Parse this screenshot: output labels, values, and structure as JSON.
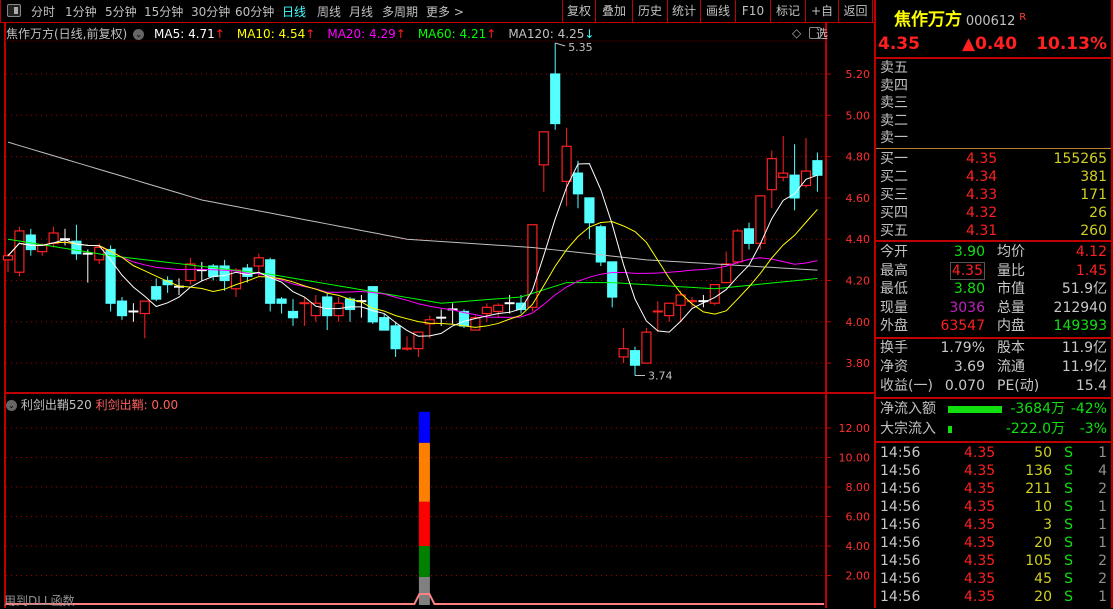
{
  "toolbar": {
    "periods": [
      "分时",
      "1分钟",
      "5分钟",
      "15分钟",
      "30分钟",
      "60分钟",
      "日线",
      "周线",
      "月线",
      "多周期",
      "更多 >"
    ],
    "active": "日线",
    "buttons": [
      "复权",
      "叠加",
      "历史",
      "统计",
      "画线",
      "F10",
      "标记",
      "+自选",
      "返回"
    ]
  },
  "main": {
    "title": "焦作万方(日线,前复权)",
    "ma": [
      {
        "label": "MA5: 4.71",
        "arrow": "↑",
        "color": "#ffffff"
      },
      {
        "label": "MA10: 4.54",
        "arrow": "↑",
        "color": "#ffff00"
      },
      {
        "label": "MA20: 4.29",
        "arrow": "↑",
        "color": "#ff00ff"
      },
      {
        "label": "MA60: 4.21",
        "arrow": "↑",
        "color": "#00ff00"
      },
      {
        "label": "MA120: 4.25",
        "arrow": "↓",
        "color": "#c0c0c0"
      }
    ],
    "high_marker": "5.35",
    "low_marker": "3.74"
  },
  "indicator": {
    "name": "利剑出鞘520",
    "series_label": "利剑出鞘: 0.00",
    "footer": "用到DLL函数"
  },
  "quote": {
    "name": "焦作万方",
    "code": "000612",
    "flag": "R",
    "price": "4.35",
    "change": "▲0.40",
    "pct": "10.13%",
    "sell": [
      {
        "label": "卖五"
      },
      {
        "label": "卖四"
      },
      {
        "label": "卖三"
      },
      {
        "label": "卖二"
      },
      {
        "label": "卖一"
      }
    ],
    "buy": [
      {
        "label": "买一",
        "price": "4.35",
        "vol": "155265"
      },
      {
        "label": "买二",
        "price": "4.34",
        "vol": "381"
      },
      {
        "label": "买三",
        "price": "4.33",
        "vol": "171"
      },
      {
        "label": "买四",
        "price": "4.32",
        "vol": "26"
      },
      {
        "label": "买五",
        "price": "4.31",
        "vol": "260"
      }
    ],
    "stats": [
      {
        "l1": "今开",
        "v1": "3.90",
        "c1": "grn",
        "l2": "均价",
        "v2": "4.12",
        "c2": "red"
      },
      {
        "l1": "最高",
        "v1": "4.35",
        "c1": "red",
        "l2": "量比",
        "v2": "1.45",
        "c2": "red"
      },
      {
        "l1": "最低",
        "v1": "3.80",
        "c1": "grn",
        "l2": "市值",
        "v2": "51.9亿",
        "c2": "wh"
      },
      {
        "l1": "现量",
        "v1": "3036",
        "c1": "mag",
        "l2": "总量",
        "v2": "212940",
        "c2": "wh"
      },
      {
        "l1": "外盘",
        "v1": "63547",
        "c1": "red",
        "l2": "内盘",
        "v2": "149393",
        "c2": "grn"
      }
    ],
    "fin": [
      {
        "l1": "换手",
        "v1": "1.79%",
        "l2": "股本",
        "v2": "11.9亿"
      },
      {
        "l1": "净资",
        "v1": "3.69",
        "l2": "流通",
        "v2": "11.9亿"
      },
      {
        "l1": "收益(一)",
        "v1": "0.070",
        "l2": "PE(动)",
        "v2": "15.4"
      }
    ],
    "flow": [
      {
        "label": "净流入额",
        "value": "-3684万",
        "pct": "-42%",
        "bar": 0.42
      },
      {
        "label": "大宗流入",
        "value": "-222.0万",
        "pct": "-3%",
        "bar": 0.03
      }
    ],
    "ticks": [
      {
        "t": "14:56",
        "p": "4.35",
        "v": "50",
        "s": "S",
        "n": "1"
      },
      {
        "t": "14:56",
        "p": "4.35",
        "v": "136",
        "s": "S",
        "n": "4"
      },
      {
        "t": "14:56",
        "p": "4.35",
        "v": "211",
        "s": "S",
        "n": "2"
      },
      {
        "t": "14:56",
        "p": "4.35",
        "v": "10",
        "s": "S",
        "n": "1"
      },
      {
        "t": "14:56",
        "p": "4.35",
        "v": "3",
        "s": "S",
        "n": "1"
      },
      {
        "t": "14:56",
        "p": "4.35",
        "v": "20",
        "s": "S",
        "n": "1"
      },
      {
        "t": "14:56",
        "p": "4.35",
        "v": "105",
        "s": "S",
        "n": "2"
      },
      {
        "t": "14:56",
        "p": "4.35",
        "v": "45",
        "s": "S",
        "n": "2"
      },
      {
        "t": "14:56",
        "p": "4.35",
        "v": "20",
        "s": "S",
        "n": "1"
      }
    ]
  },
  "chart_data": [
    {
      "type": "candlestick",
      "title": "焦作万方(日线,前复权)",
      "ylim": [
        3.72,
        5.38
      ],
      "yticks": [
        "5.20",
        "5.00",
        "4.80",
        "4.60",
        "4.40",
        "4.20",
        "4.00",
        "3.80"
      ],
      "ohlc": [
        [
          4.3,
          4.33,
          4.24,
          4.32
        ],
        [
          4.24,
          4.46,
          4.22,
          4.44
        ],
        [
          4.42,
          4.45,
          4.32,
          4.35
        ],
        [
          4.34,
          4.38,
          4.32,
          4.37
        ],
        [
          4.38,
          4.46,
          4.36,
          4.43
        ],
        [
          4.4,
          4.45,
          4.37,
          4.4
        ],
        [
          4.39,
          4.47,
          4.3,
          4.33
        ],
        [
          4.33,
          4.35,
          4.19,
          4.32
        ],
        [
          4.3,
          4.38,
          4.28,
          4.36
        ],
        [
          4.35,
          4.37,
          4.05,
          4.09
        ],
        [
          4.1,
          4.12,
          4.01,
          4.03
        ],
        [
          4.05,
          4.09,
          4.0,
          4.04
        ],
        [
          4.04,
          4.1,
          3.92,
          4.1
        ],
        [
          4.17,
          4.21,
          4.1,
          4.11
        ],
        [
          4.2,
          4.22,
          4.14,
          4.18
        ],
        [
          4.17,
          4.21,
          4.13,
          4.17
        ],
        [
          4.2,
          4.31,
          4.18,
          4.28
        ],
        [
          4.25,
          4.29,
          4.2,
          4.25
        ],
        [
          4.27,
          4.28,
          4.2,
          4.22
        ],
        [
          4.27,
          4.3,
          4.15,
          4.2
        ],
        [
          4.16,
          4.26,
          4.12,
          4.25
        ],
        [
          4.26,
          4.28,
          4.19,
          4.22
        ],
        [
          4.27,
          4.33,
          4.22,
          4.31
        ],
        [
          4.3,
          4.31,
          4.05,
          4.09
        ],
        [
          4.11,
          4.12,
          4.04,
          4.09
        ],
        [
          4.05,
          4.11,
          3.98,
          4.02
        ],
        [
          4.08,
          4.12,
          3.98,
          4.09
        ],
        [
          4.03,
          4.13,
          4.0,
          4.09
        ],
        [
          4.12,
          4.14,
          3.96,
          4.03
        ],
        [
          4.03,
          4.12,
          4.0,
          4.09
        ],
        [
          4.11,
          4.12,
          4.0,
          4.06
        ],
        [
          4.1,
          4.13,
          4.02,
          4.09
        ],
        [
          4.17,
          4.17,
          3.99,
          4.0
        ],
        [
          4.02,
          4.04,
          3.96,
          3.96
        ],
        [
          3.98,
          4.0,
          3.83,
          3.87
        ],
        [
          3.86,
          3.93,
          3.86,
          3.87
        ],
        [
          3.87,
          3.95,
          3.83,
          3.95
        ],
        [
          3.99,
          4.03,
          3.92,
          4.01
        ],
        [
          4.02,
          4.06,
          3.98,
          4.02
        ],
        [
          4.06,
          4.09,
          3.99,
          4.05
        ],
        [
          4.05,
          4.06,
          3.97,
          3.98
        ],
        [
          3.96,
          4.03,
          3.96,
          4.02
        ],
        [
          4.04,
          4.09,
          4.0,
          4.07
        ],
        [
          4.05,
          4.09,
          4.02,
          4.08
        ],
        [
          4.09,
          4.13,
          4.04,
          4.08
        ],
        [
          4.09,
          4.13,
          4.04,
          4.06
        ],
        [
          4.07,
          4.47,
          4.05,
          4.47
        ],
        [
          4.76,
          4.92,
          4.63,
          4.92
        ],
        [
          5.2,
          5.35,
          4.93,
          4.96
        ],
        [
          4.68,
          4.94,
          4.56,
          4.85
        ],
        [
          4.72,
          4.78,
          4.55,
          4.62
        ],
        [
          4.6,
          4.6,
          4.4,
          4.48
        ],
        [
          4.46,
          4.47,
          4.27,
          4.29
        ],
        [
          4.29,
          4.29,
          4.07,
          4.12
        ],
        [
          3.83,
          3.97,
          3.8,
          3.87
        ],
        [
          3.86,
          3.88,
          3.74,
          3.79
        ],
        [
          3.8,
          3.97,
          3.8,
          3.95
        ],
        [
          4.04,
          4.1,
          3.95,
          4.05
        ],
        [
          4.03,
          4.09,
          4.0,
          4.09
        ],
        [
          4.08,
          4.15,
          4.0,
          4.13
        ],
        [
          4.09,
          4.12,
          4.07,
          4.1
        ],
        [
          4.1,
          4.13,
          4.07,
          4.09
        ],
        [
          4.09,
          4.18,
          4.08,
          4.18
        ],
        [
          4.19,
          4.34,
          4.19,
          4.28
        ],
        [
          4.29,
          4.45,
          4.28,
          4.44
        ],
        [
          4.45,
          4.48,
          4.35,
          4.38
        ],
        [
          4.38,
          4.61,
          4.35,
          4.61
        ],
        [
          4.64,
          4.83,
          4.55,
          4.79
        ],
        [
          4.7,
          4.9,
          4.68,
          4.72
        ],
        [
          4.71,
          4.86,
          4.54,
          4.6
        ],
        [
          4.66,
          4.89,
          4.65,
          4.73
        ],
        [
          4.78,
          4.82,
          4.63,
          4.71
        ]
      ],
      "ma60": [
        [
          0,
          4.4
        ],
        [
          9,
          4.32
        ],
        [
          23,
          4.23
        ],
        [
          38,
          4.09
        ],
        [
          45,
          4.12
        ],
        [
          49,
          4.19
        ],
        [
          53,
          4.19
        ],
        [
          62,
          4.16
        ],
        [
          71,
          4.21
        ]
      ],
      "ma120": [
        [
          0,
          4.87
        ],
        [
          17,
          4.59
        ],
        [
          35,
          4.4
        ],
        [
          46,
          4.36
        ],
        [
          56,
          4.3
        ],
        [
          71,
          4.25
        ]
      ]
    },
    {
      "type": "stacked-bar",
      "title": "利剑出鞘520",
      "ylim": [
        0,
        14
      ],
      "yticks": [
        "12.00",
        "10.00",
        "8.00",
        "6.00",
        "4.00",
        "2.00"
      ],
      "bar_index": 36,
      "segments": [
        {
          "from": 0,
          "to": 1.9,
          "color": "#808080"
        },
        {
          "from": 1.9,
          "to": 4.0,
          "color": "#008000"
        },
        {
          "from": 4.0,
          "to": 7.0,
          "color": "#ff0000"
        },
        {
          "from": 7.0,
          "to": 11.0,
          "color": "#ff8000"
        },
        {
          "from": 11.0,
          "to": 13.1,
          "color": "#0000ff"
        }
      ],
      "line_value": 0.0
    }
  ]
}
